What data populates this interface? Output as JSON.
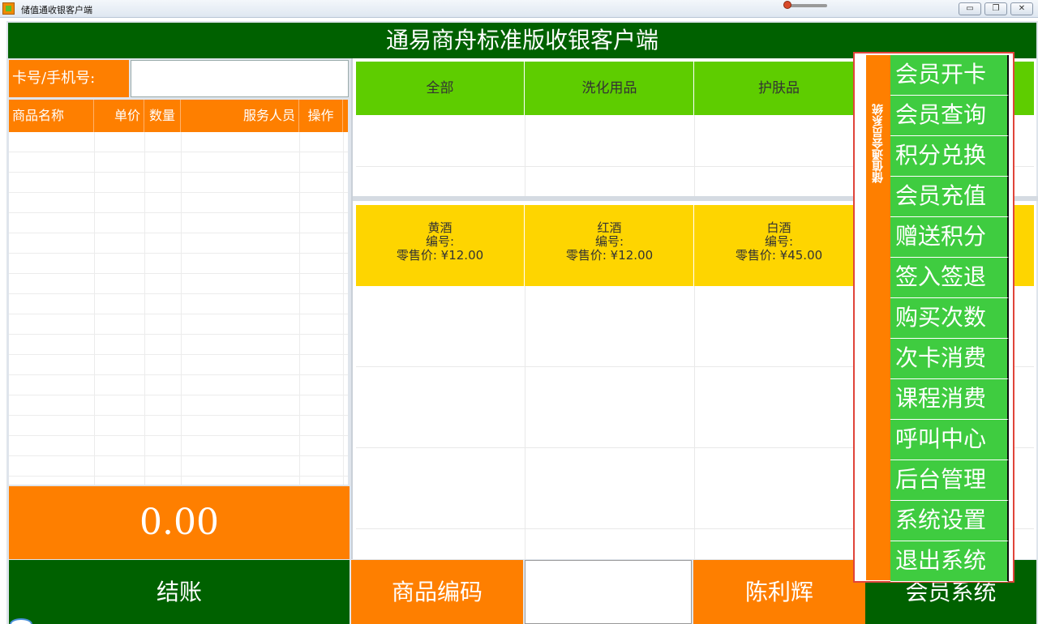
{
  "window": {
    "title": "储值通收银客户端",
    "min_label": "▭",
    "max_label": "❐",
    "close_label": "✕"
  },
  "header": {
    "title": "通易商舟标准版收银客户端"
  },
  "card": {
    "label": "卡号/手机号:",
    "value": ""
  },
  "cart": {
    "columns": [
      "商品名称",
      "单价",
      "数量",
      "服务人员",
      "操作"
    ],
    "rows": []
  },
  "total": {
    "amount": "0.00"
  },
  "checkout": {
    "label": "结账"
  },
  "categories": [
    "全部",
    "洗化用品",
    "护肤品"
  ],
  "products": [
    {
      "name": "黄酒",
      "code_label": "编号:",
      "price_label": "零售价: ¥12.00"
    },
    {
      "name": "红酒",
      "code_label": "编号:",
      "price_label": "零售价: ¥12.00"
    },
    {
      "name": "白酒",
      "code_label": "编号:",
      "price_label": "零售价: ¥45.00"
    }
  ],
  "bottom": {
    "code_label": "商品编码",
    "code_value": "",
    "user_name": "陈利辉",
    "member_system_label": "会员系统"
  },
  "member_menu": {
    "title": "储值通会员系统",
    "items": [
      "会员开卡",
      "会员查询",
      "积分兑换",
      "会员充值",
      "赠送积分",
      "签入签退",
      "购买次数",
      "次卡消费",
      "课程消费",
      "呼叫中心",
      "后台管理",
      "系统设置",
      "退出系统"
    ]
  },
  "colors": {
    "green_dark": "#006100",
    "orange": "#fe7f00",
    "green_light": "#5ecd00",
    "yellow": "#fed500",
    "menu_green": "#3fcc40",
    "highlight_red": "#e0443a"
  }
}
